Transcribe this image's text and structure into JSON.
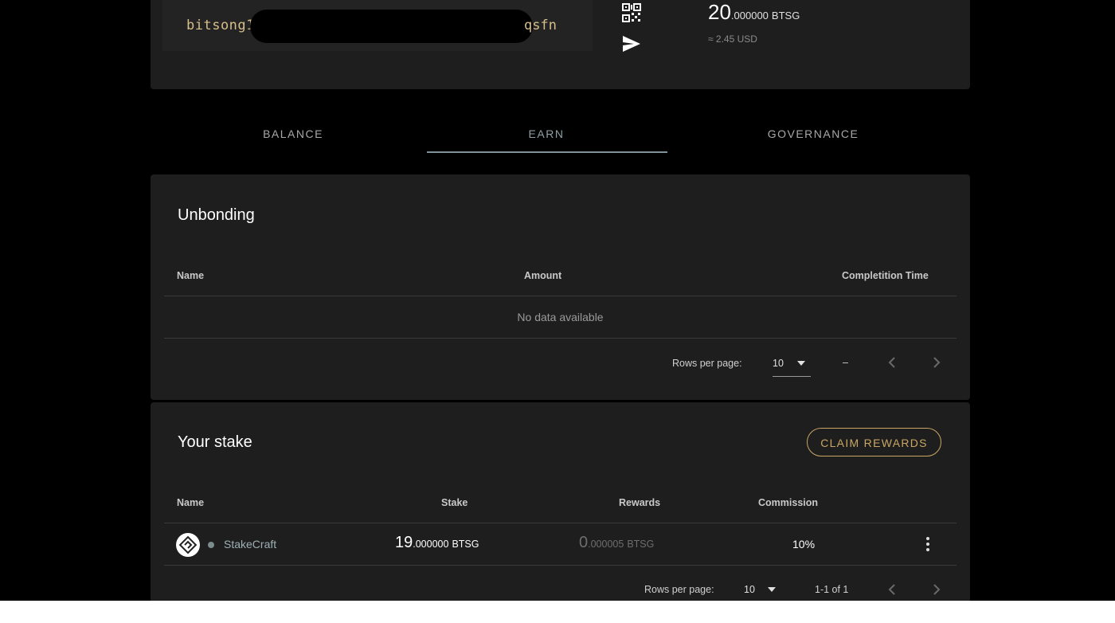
{
  "account": {
    "address_prefix": "bitsong1",
    "address_suffix": "qsfn",
    "qr_icon": "qr-code-icon",
    "send_icon": "send-icon",
    "balance_int": "20",
    "balance_dec": ".000000",
    "balance_unit": "BTSG",
    "balance_usd": "≈ 2.45 USD"
  },
  "tabs": [
    {
      "label": "BALANCE",
      "active": false
    },
    {
      "label": "EARN",
      "active": true
    },
    {
      "label": "GOVERNANCE",
      "active": false
    }
  ],
  "unbonding": {
    "title": "Unbonding",
    "columns": [
      "Name",
      "Amount",
      "Completition Time"
    ],
    "empty_message": "No data available",
    "pagination": {
      "rows_label": "Rows per page:",
      "rows_value": "10",
      "range": "–"
    }
  },
  "stake": {
    "title": "Your stake",
    "claim_label": "CLAIM REWARDS",
    "columns": [
      "Name",
      "Stake",
      "Rewards",
      "Commission"
    ],
    "rows": [
      {
        "validator": "StakeCraft",
        "stake_int": "19",
        "stake_dec": ".000000",
        "stake_unit": "BTSG",
        "rewards_int": "0",
        "rewards_dec": ".000005",
        "rewards_unit": "BTSG",
        "commission": "10%"
      }
    ],
    "pagination": {
      "rows_label": "Rows per page:",
      "rows_value": "10",
      "range": "1-1 of 1"
    }
  },
  "colors": {
    "accent_gold": "#c9a664",
    "tab_indicator": "#7f9299",
    "card_bg": "#1e1e1e"
  }
}
